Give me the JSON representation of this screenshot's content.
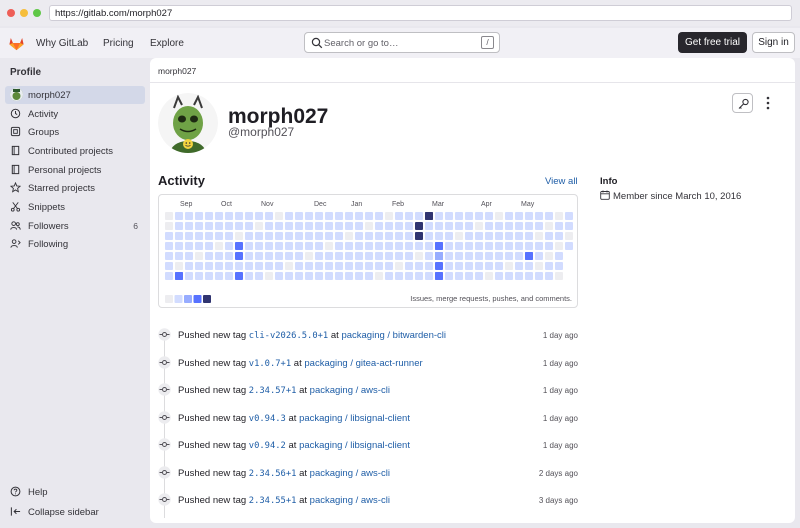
{
  "browser": {
    "url": "https://gitlab.com/morph027",
    "colors": {
      "close": "#ee5e57",
      "min": "#f6be3c",
      "max": "#5fc747"
    }
  },
  "topnav": {
    "logo_icon": "gitlab-tanuki-icon",
    "links": [
      "Why GitLab",
      "Pricing",
      "Explore"
    ],
    "search_placeholder": "Search or go to…",
    "search_shortcut": "/",
    "trial_button": "Get free trial",
    "signin_button": "Sign in"
  },
  "sidebar": {
    "title": "Profile",
    "items": [
      {
        "label": "morph027",
        "icon": "avatar",
        "active": true
      },
      {
        "label": "Activity",
        "icon": "history-icon"
      },
      {
        "label": "Groups",
        "icon": "group-icon"
      },
      {
        "label": "Contributed projects",
        "icon": "project-icon"
      },
      {
        "label": "Personal projects",
        "icon": "project-icon"
      },
      {
        "label": "Starred projects",
        "icon": "star-icon"
      },
      {
        "label": "Snippets",
        "icon": "snippet-icon"
      },
      {
        "label": "Followers",
        "icon": "users-icon",
        "count": "6"
      },
      {
        "label": "Following",
        "icon": "following-icon"
      }
    ],
    "help": "Help",
    "collapse": "Collapse sidebar"
  },
  "main": {
    "breadcrumb": "morph027",
    "name": "morph027",
    "username": "@morph027",
    "activity": {
      "heading": "Activity",
      "view_all": "View all",
      "months": [
        "Sep",
        "Oct",
        "Nov",
        "Dec",
        "Jan",
        "Feb",
        "Mar",
        "Apr",
        "May"
      ],
      "legend_text": "Issues, merge requests, pushes, and comments.",
      "colors": [
        "#ededf0",
        "#d2dcff",
        "#97acff",
        "#5772ff",
        "#303470"
      ]
    },
    "info": {
      "heading": "Info",
      "member_since": "Member since March 10, 2016"
    },
    "events": [
      {
        "action": "Pushed new tag",
        "tag": "cli-v2026.5.0+1",
        "at": "at",
        "project": "packaging / bitwarden-cli",
        "time": "1 day ago"
      },
      {
        "action": "Pushed new tag",
        "tag": "v1.0.7+1",
        "at": "at",
        "project": "packaging / gitea-act-runner",
        "time": "1 day ago"
      },
      {
        "action": "Pushed new tag",
        "tag": "2.34.57+1",
        "at": "at",
        "project": "packaging / aws-cli",
        "time": "1 day ago"
      },
      {
        "action": "Pushed new tag",
        "tag": "v0.94.3",
        "at": "at",
        "project": "packaging / libsignal-client",
        "time": "1 day ago"
      },
      {
        "action": "Pushed new tag",
        "tag": "v0.94.2",
        "at": "at",
        "project": "packaging / libsignal-client",
        "time": "1 day ago"
      },
      {
        "action": "Pushed new tag",
        "tag": "2.34.56+1",
        "at": "at",
        "project": "packaging / aws-cli",
        "time": "2 days ago"
      },
      {
        "action": "Pushed new tag",
        "tag": "2.34.55+1",
        "at": "at",
        "project": "packaging / aws-cli",
        "time": "3 days ago"
      }
    ]
  }
}
